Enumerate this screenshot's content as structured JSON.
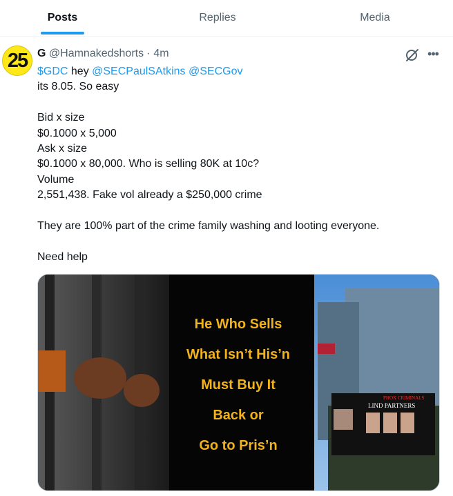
{
  "tabs": [
    {
      "label": "Posts",
      "active": true
    },
    {
      "label": "Replies",
      "active": false
    },
    {
      "label": "Media",
      "active": false
    }
  ],
  "avatar": {
    "text": "25"
  },
  "post": {
    "display_name": "G",
    "handle": "@Hamnakedshorts",
    "separator": "·",
    "time": "4m",
    "lines": [
      [
        {
          "text": "$GDC",
          "link": true
        },
        {
          "text": " hey ",
          "link": false
        },
        {
          "text": "@SECPaulSAtkins",
          "link": true
        },
        {
          "text": " ",
          "link": false
        },
        {
          "text": "@SECGov",
          "link": true
        }
      ],
      [
        {
          "text": "its 8.05. So easy",
          "link": false
        }
      ],
      [],
      [
        {
          "text": "Bid x size",
          "link": false
        }
      ],
      [
        {
          "text": "$0.1000 x 5,000",
          "link": false
        }
      ],
      [
        {
          "text": "Ask x size",
          "link": false
        }
      ],
      [
        {
          "text": "$0.1000 x 80,000. Who is selling 80K at 10c?",
          "link": false
        }
      ],
      [
        {
          "text": "Volume",
          "link": false
        }
      ],
      [
        {
          "text": "2,551,438. Fake vol already a $250,000 crime",
          "link": false
        }
      ],
      [],
      [
        {
          "text": "They are 100% part of the crime family washing and looting everyone.",
          "link": false
        }
      ],
      [],
      [
        {
          "text": "Need help",
          "link": false
        }
      ]
    ],
    "image": {
      "lines": [
        "He Who Sells",
        "What Isn’t His’n",
        "Must Buy It",
        "Back or",
        "Go to Pris’n"
      ],
      "truck_top": "PHOX CRIMINALS",
      "truck_brand": "LIND PARTNERS"
    }
  },
  "colors": {
    "accent": "#1d9bf0",
    "muted": "#536471",
    "image_text": "#f2b21b",
    "avatar": "#ffe81a"
  },
  "icons": {
    "grok": "grok-icon",
    "more": "more-icon"
  }
}
